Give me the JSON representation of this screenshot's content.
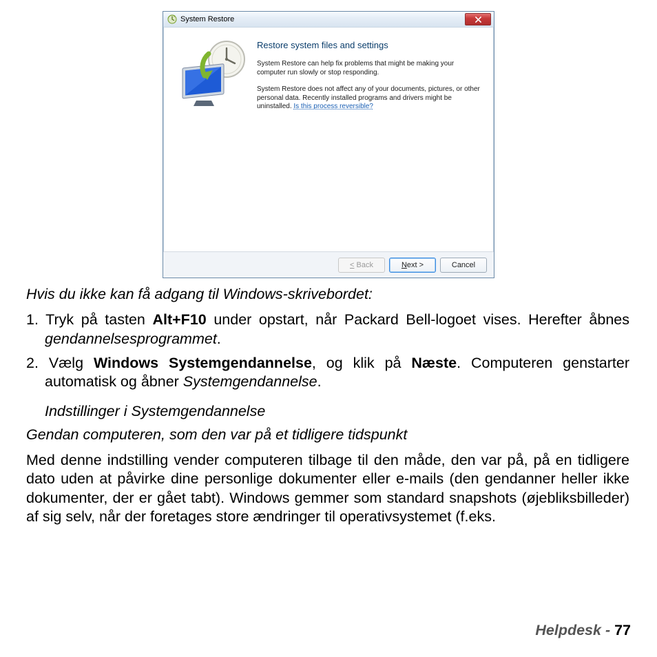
{
  "window": {
    "title": "System Restore",
    "dialog_title": "Restore system files and settings",
    "para1": "System Restore can help fix problems that might be making your computer run slowly or stop responding.",
    "para2_a": "System Restore does not affect any of your documents, pictures, or other personal data. Recently installed programs and drivers might be uninstalled. ",
    "link": "Is this process reversible?",
    "btn_back": "< Back",
    "btn_next": "Next >",
    "btn_cancel": "Cancel"
  },
  "doc": {
    "heading": "Hvis du ikke kan få adgang til Windows-skrivebordet:",
    "li1_a": "Tryk på tasten ",
    "li1_b": "Alt+F10",
    "li1_c": " under opstart, når Packard Bell-logoet vises. Herefter åbnes ",
    "li1_d": "gendannelsesprogrammet",
    "li1_e": ".",
    "li2_a": "Vælg ",
    "li2_b": "Windows Systemgendannelse",
    "li2_c": ", og klik på ",
    "li2_d": "Næste",
    "li2_e": ". Computeren genstarter automatisk og åbner ",
    "li2_f": "Systemgendannelse",
    "li2_g": ".",
    "subhead": "Indstillinger i Systemgendannelse",
    "subhead2": "Gendan computeren, som den var på et tidligere tidspunkt",
    "body": "Med denne indstilling vender computeren tilbage til den måde, den var på, på en tidligere dato uden at påvirke dine personlige dokumenter eller e-mails (den gendanner heller ikke dokumenter, der er gået tabt). Windows gemmer som standard snapshots (øjebliksbilleder) af sig selv, når der foretages store ændringer til operativsystemet (f.eks."
  },
  "footer": {
    "label": "Helpdesk -  ",
    "page": "77"
  }
}
